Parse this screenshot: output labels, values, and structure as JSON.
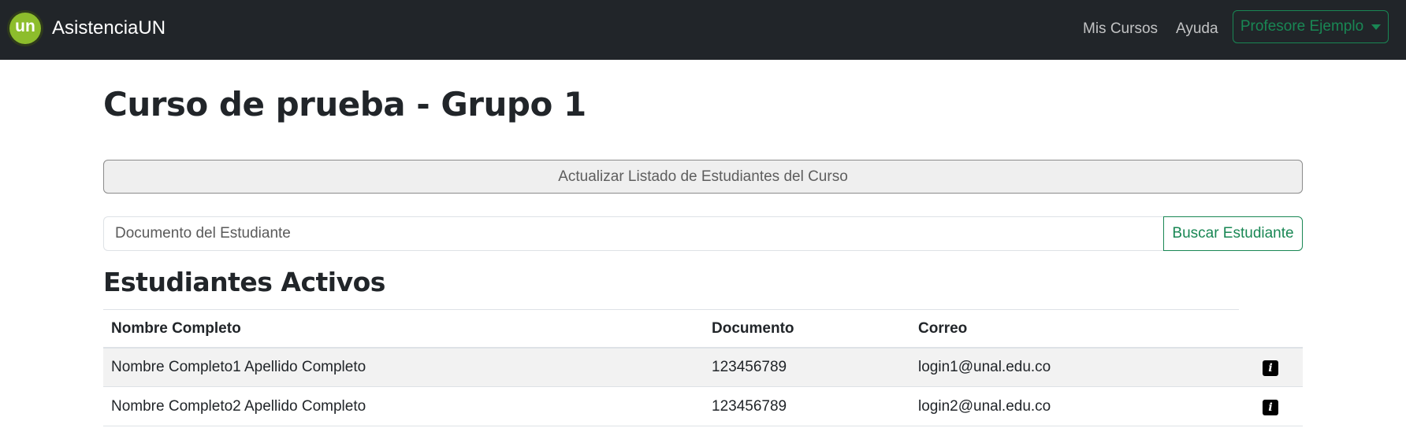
{
  "navbar": {
    "logo_text": "un",
    "brand": "AsistenciaUN",
    "links": [
      "Mis Cursos",
      "Ayuda"
    ],
    "user_menu": "Profesore Ejemplo"
  },
  "page": {
    "title": "Curso de prueba - Grupo 1",
    "update_button": "Actualizar Listado de Estudiantes del Curso",
    "search_placeholder": "Documento del Estudiante",
    "search_button": "Buscar Estudiante"
  },
  "students": {
    "title": "Estudiantes Activos",
    "columns": [
      "Nombre Completo",
      "Documento",
      "Correo"
    ],
    "rows": [
      {
        "name": "Nombre Completo1 Apellido Completo",
        "document": "123456789",
        "email": "login1@unal.edu.co"
      },
      {
        "name": "Nombre Completo2 Apellido Completo",
        "document": "123456789",
        "email": "login2@unal.edu.co"
      }
    ]
  },
  "colors": {
    "navbar_bg": "#212529",
    "accent_green": "#198754",
    "logo_green": "#8dbd2c"
  },
  "icons": {
    "row_action": "info-icon",
    "user_menu": "chevron-down-icon"
  }
}
